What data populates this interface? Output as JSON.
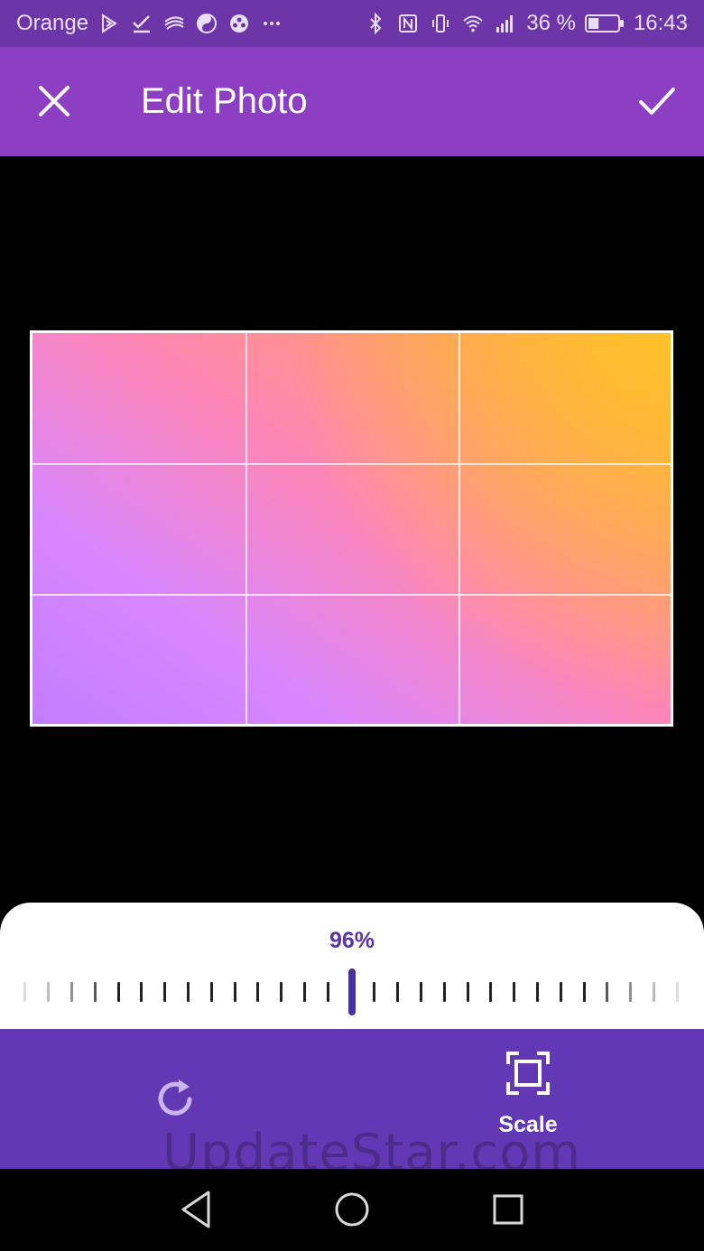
{
  "status_bar": {
    "carrier": "Orange",
    "battery_percent": "36 %",
    "battery_level": 0.36,
    "time": "16:43",
    "icons": [
      "play-store-icon",
      "check-icon",
      "swirl-icon",
      "yin-yang-icon",
      "ball-icon",
      "more-icon",
      "bluetooth-icon",
      "nfc-icon",
      "vibrate-icon",
      "wifi-icon",
      "signal-icon",
      "battery-icon"
    ]
  },
  "app_bar": {
    "title": "Edit Photo",
    "close_icon": "close-icon",
    "confirm_icon": "check-icon"
  },
  "slider": {
    "value_label": "96%",
    "value_percent": 96
  },
  "toolbar": {
    "rotate_icon": "rotate-icon",
    "scale_label": "Scale",
    "scale_icon": "scale-frame-icon"
  },
  "watermark": "UpdateStar.com",
  "nav_bar": {
    "icons": [
      "back-icon",
      "home-icon",
      "recents-icon"
    ]
  },
  "colors": {
    "status_bar": "#6c36a8",
    "app_bar": "#8c3fc2",
    "toolbar": "#6238b4",
    "accent": "#5b35a7"
  }
}
